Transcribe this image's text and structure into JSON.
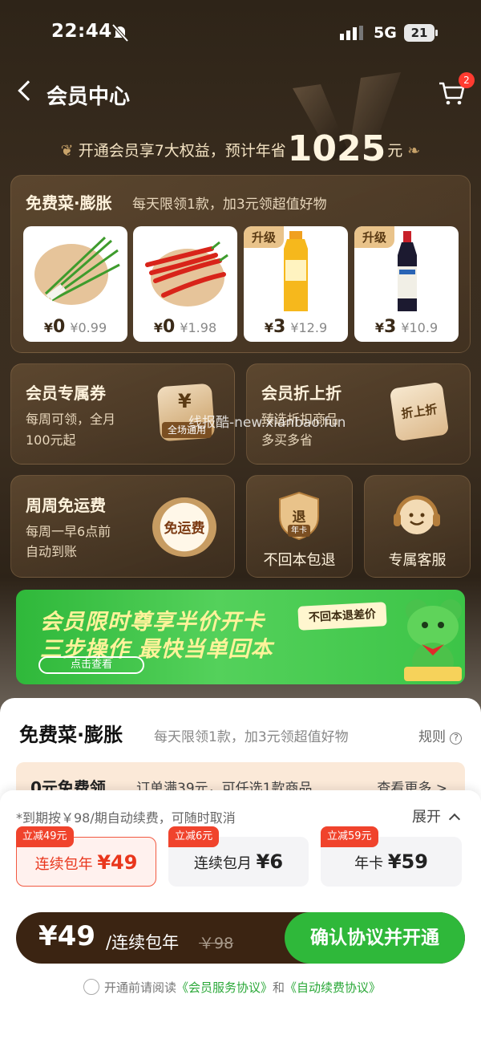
{
  "status_bar": {
    "time": "22:44",
    "network": "5G",
    "battery": "21"
  },
  "header": {
    "title": "会员中心",
    "cart_badge": "2"
  },
  "savings": {
    "prefix": "开通会员享7大权益，预计年省",
    "amount": "1025",
    "suffix": "元"
  },
  "free_veg": {
    "title": "免费菜·膨胀",
    "subtitle": "每天限领1款，加3元领超值好物",
    "products": [
      {
        "upgrade": "",
        "currency": "¥",
        "price": "0",
        "original": "¥0.99"
      },
      {
        "upgrade": "",
        "currency": "¥",
        "price": "0",
        "original": "¥1.98"
      },
      {
        "upgrade": "升级",
        "currency": "¥",
        "price": "3",
        "original": "¥12.9"
      },
      {
        "upgrade": "升级",
        "currency": "¥",
        "price": "3",
        "original": "¥10.9"
      }
    ]
  },
  "benefits": {
    "coupon": {
      "title": "会员专属券",
      "line1": "每周可领，全月",
      "line2": "100元起",
      "badge": "全场通用",
      "icon_char": "¥"
    },
    "discount": {
      "title": "会员折上折",
      "line1": "臻选折扣商品",
      "line2": "多买多省",
      "icon_text": "折上折"
    },
    "shipping": {
      "title": "周周免运费",
      "line1": "每周一早6点前",
      "line2": "自动到账",
      "icon_text": "免运费"
    },
    "refund": {
      "label": "不回本包退",
      "icon_char": "退",
      "icon_sub": "年卡"
    },
    "service": {
      "label": "专属客服"
    }
  },
  "promo": {
    "line1": "会员限时尊享半价开卡",
    "line2": "三步操作 最快当单回本",
    "button": "点击查看",
    "tag": "不回本退差价"
  },
  "sheet": {
    "title": "免费菜·膨胀",
    "subtitle": "每天限领1款，加3元领超值好物",
    "rules": "规则",
    "strip": {
      "title": "0元免费领",
      "sub": "订单满39元，可任选1款商品",
      "more": "查看更多 >"
    }
  },
  "plans": {
    "renew_note": "*到期按￥98/期自动续费，可随时取消",
    "expand": "展开",
    "items": [
      {
        "tag": "立减49元",
        "label": "连续包年",
        "price": "¥49"
      },
      {
        "tag": "立减6元",
        "label": "连续包月",
        "price": "¥6"
      },
      {
        "tag": "立减59元",
        "label": "年卡",
        "price": "¥59"
      }
    ]
  },
  "pay": {
    "amount": "¥49",
    "period": "/连续包年",
    "original": "￥98",
    "confirm": "确认协议并开通"
  },
  "agreement": {
    "prefix": "开通前请阅读",
    "link1": "《会员服务协议》",
    "and": "和",
    "link2": "《自动续费协议》"
  },
  "watermark": "线报酷-new.xianbao.fun",
  "colors": {
    "accent_green": "#2fb83a",
    "red": "#f0432c",
    "brown": "#3b2412"
  }
}
